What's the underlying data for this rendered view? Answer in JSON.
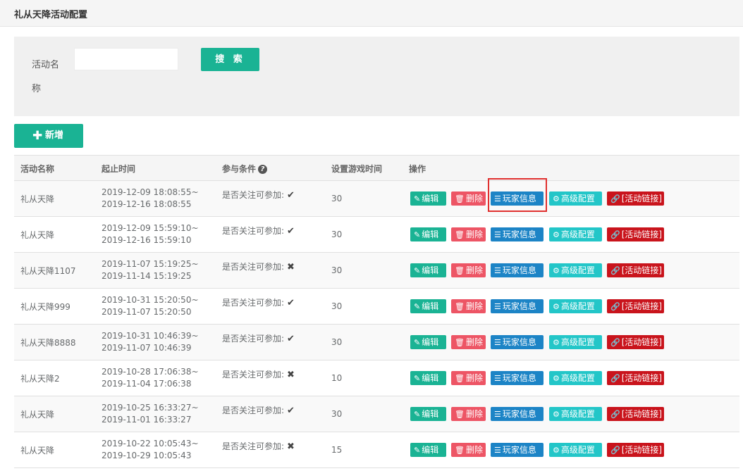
{
  "page": {
    "title": "礼从天降活动配置"
  },
  "search": {
    "label": "活动名称",
    "input_value": "",
    "button_label": "搜 索"
  },
  "add_button": {
    "icon": "plus-icon",
    "label": "新增"
  },
  "table": {
    "headers": [
      "活动名称",
      "起止时间",
      "参与条件",
      "设置游戏时间",
      "操作"
    ],
    "help_icon": "question-circle-icon",
    "action_labels": {
      "edit": "编辑",
      "delete": "删除",
      "player_info": "玩家信息",
      "advanced": "高级配置",
      "link": "[活动链接]"
    },
    "action_icons": {
      "edit": "edit-icon",
      "delete": "trash-icon",
      "player_info": "list-icon",
      "advanced": "gears-icon",
      "link": "link-icon"
    },
    "action_colors": {
      "edit": "#1ab394",
      "delete": "#ed5565",
      "player_info": "#1c84c6",
      "advanced": "#23c6c8",
      "link": "#c9141c"
    },
    "rows": [
      {
        "name": "礼从天降",
        "start": "2019-12-09 18:08:55~",
        "end": "2019-12-16 18:08:55",
        "condition": "是否关注可参加:",
        "mark": "✔",
        "duration": "30"
      },
      {
        "name": "礼从天降",
        "start": "2019-12-09 15:59:10~",
        "end": "2019-12-16 15:59:10",
        "condition": "是否关注可参加:",
        "mark": "✔",
        "duration": "30"
      },
      {
        "name": "礼从天降1107",
        "start": "2019-11-07 15:19:25~",
        "end": "2019-11-14 15:19:25",
        "condition": "是否关注可参加:",
        "mark": "✖",
        "duration": "30"
      },
      {
        "name": "礼从天降999",
        "start": "2019-10-31 15:20:50~",
        "end": "2019-11-07 15:20:50",
        "condition": "是否关注可参加:",
        "mark": "✔",
        "duration": "30"
      },
      {
        "name": "礼从天降8888",
        "start": "2019-10-31 10:46:39~",
        "end": "2019-11-07 10:46:39",
        "condition": "是否关注可参加:",
        "mark": "✔",
        "duration": "30"
      },
      {
        "name": "礼从天降2",
        "start": "2019-10-28 17:06:38~",
        "end": "2019-11-04 17:06:38",
        "condition": "是否关注可参加:",
        "mark": "✖",
        "duration": "10"
      },
      {
        "name": "礼从天降",
        "start": "2019-10-25 16:33:27~",
        "end": "2019-11-01 16:33:27",
        "condition": "是否关注可参加:",
        "mark": "✔",
        "duration": "30"
      },
      {
        "name": "礼从天降",
        "start": "2019-10-22 10:05:43~",
        "end": "2019-10-29 10:05:43",
        "condition": "是否关注可参加:",
        "mark": "✖",
        "duration": "15"
      }
    ]
  }
}
